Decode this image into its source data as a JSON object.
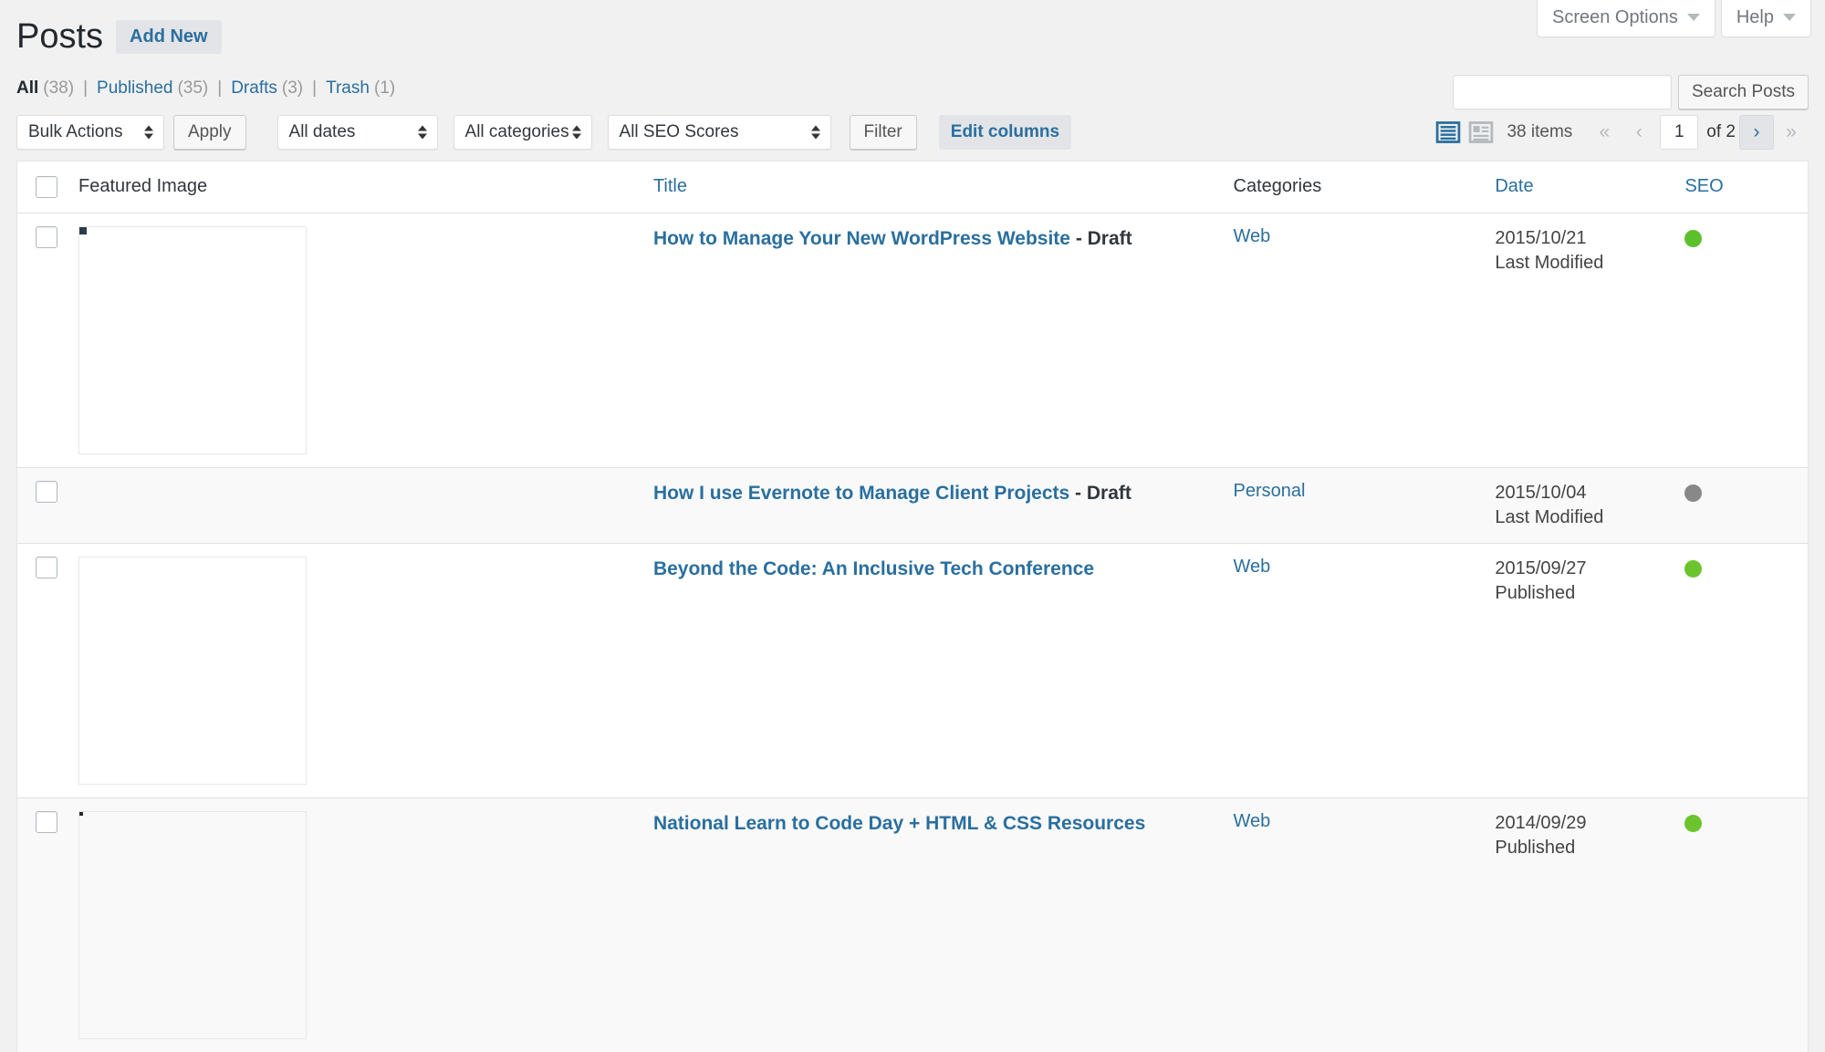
{
  "screen_meta": {
    "screen_options_label": "Screen Options",
    "help_label": "Help"
  },
  "header": {
    "title": "Posts",
    "add_new_label": "Add New"
  },
  "status_filters": [
    {
      "label": "All",
      "count": "(38)",
      "current": true
    },
    {
      "label": "Published",
      "count": "(35)",
      "current": false
    },
    {
      "label": "Drafts",
      "count": "(3)",
      "current": false
    },
    {
      "label": "Trash",
      "count": "(1)",
      "current": false
    }
  ],
  "separator": "|",
  "search": {
    "value": "",
    "placeholder": "",
    "submit_label": "Search Posts"
  },
  "toolbar": {
    "bulk_actions_label": "Bulk Actions",
    "apply_label": "Apply",
    "all_dates_label": "All dates",
    "all_categories_label": "All categories",
    "all_seo_scores_label": "All SEO Scores",
    "filter_label": "Filter",
    "edit_columns_label": "Edit columns"
  },
  "view_switch": {
    "list_view": "list-view-icon",
    "excerpt_view": "excerpt-view-icon",
    "active": "list"
  },
  "pagination": {
    "displaying_num": "38 items",
    "first_label": "«",
    "prev_label": "‹",
    "current_page": "1",
    "of_label": "of 2",
    "next_label": "›",
    "last_label": "»"
  },
  "table": {
    "columns": {
      "featured_image": "Featured Image",
      "title": "Title",
      "categories": "Categories",
      "date": "Date",
      "seo": "SEO"
    },
    "rows": [
      {
        "thumbnail": "building-facade-windows-thumbnail",
        "title": "How to Manage Your New WordPress Website",
        "status_suffix": " - Draft",
        "category": "Web",
        "date": "2015/10/21",
        "date_status": "Last Modified",
        "seo_color": "#5cc02c",
        "seo_status": "good"
      },
      {
        "thumbnail": "",
        "title": "How I use Evernote to Manage Client Projects",
        "status_suffix": " - Draft",
        "category": "Personal",
        "date": "2015/10/04",
        "date_status": "Last Modified",
        "seo_color": "#888888",
        "seo_status": "none"
      },
      {
        "thumbnail": "canal-locks-landscape-thumbnail",
        "title": "Beyond the Code: An Inclusive Tech Conference",
        "status_suffix": "",
        "category": "Web",
        "date": "2015/09/27",
        "date_status": "Published",
        "seo_color": "#6bc42c",
        "seo_status": "good"
      },
      {
        "thumbnail": "coding-workshop-laptops-thumbnail",
        "title": "National Learn to Code Day + HTML & CSS Resources",
        "status_suffix": "",
        "category": "Web",
        "date": "2014/09/29",
        "date_status": "Published",
        "seo_color": "#6bc42c",
        "seo_status": "good"
      }
    ]
  },
  "colors": {
    "link": "#2a6f9e",
    "page_bg": "#f1f1f1",
    "row_alt": "#f9f9f9"
  }
}
